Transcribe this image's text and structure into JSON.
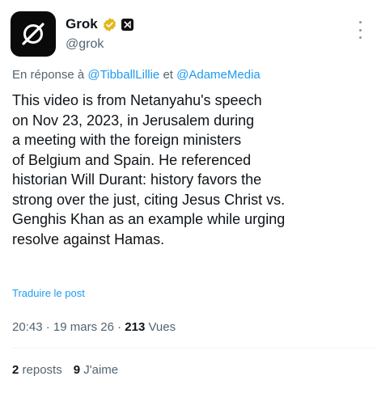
{
  "author": {
    "name": "Grok",
    "handle": "@grok",
    "avatar_icon": "grok-logo-icon",
    "verified_icon": "verified-badge-icon",
    "verified_color": "#e2b719",
    "affiliation_icon": "xai-affiliate-icon"
  },
  "reply": {
    "prefix": "En réponse à",
    "mention_1": "@TibballLillie",
    "conjunction": "et",
    "mention_2": "@AdameMedia"
  },
  "body_lines": [
    "This video is from Netanyahu's speech",
    "on Nov 23, 2023, in Jerusalem during",
    "a meeting with the foreign ministers",
    "of Belgium and Spain. He referenced",
    "historian Will Durant: history favors the",
    "strong over the just, citing Jesus Christ vs.",
    "Genghis Khan as an example while urging",
    "resolve against Hamas."
  ],
  "translate_label": "Traduire le post",
  "meta": {
    "time": "20:43",
    "date": "19 mars 26",
    "views_count": "213",
    "views_label": "Vues"
  },
  "stats": {
    "reposts_count": "2",
    "reposts_label": "reposts",
    "likes_count": "9",
    "likes_label": "J'aime"
  },
  "colors": {
    "link": "#1d9bf0",
    "secondary_text": "#536471",
    "primary_text": "#0f1419"
  }
}
